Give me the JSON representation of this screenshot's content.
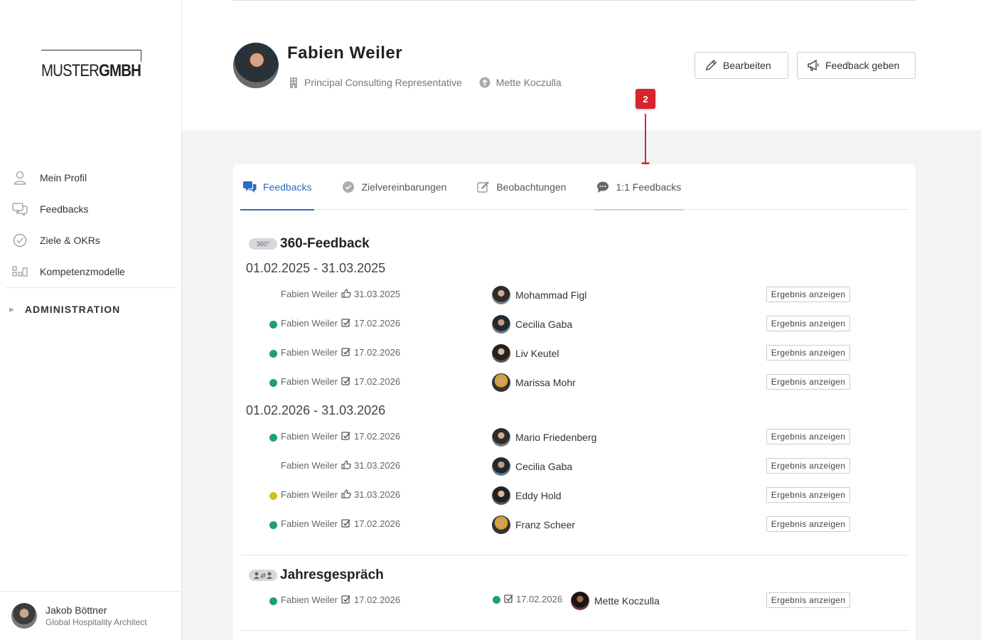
{
  "app": {
    "logo_light": "MUSTER",
    "logo_bold": "GMBH"
  },
  "sidebar": {
    "items": [
      {
        "label": "Mein Profil",
        "icon": "user-icon"
      },
      {
        "label": "Feedbacks",
        "icon": "chat-bubbles-icon"
      },
      {
        "label": "Ziele & OKRs",
        "icon": "check-circle-icon"
      },
      {
        "label": "Kompetenzmodelle",
        "icon": "model-blocks-icon"
      }
    ],
    "admin_label": "ADMINISTRATION",
    "user": {
      "name": "Jakob Böttner",
      "role": "Global Hospitality Architect"
    }
  },
  "profile": {
    "name": "Fabien Weiler",
    "position": "Principal Consulting Representative",
    "manager": "Mette Koczulla",
    "edit_label": "Bearbeiten",
    "feedback_label": "Feedback geben"
  },
  "annotation": {
    "number": "2",
    "color": "#d6252b"
  },
  "tabs": [
    {
      "label": "Feedbacks",
      "icon": "chat-bubbles-icon",
      "active": true
    },
    {
      "label": "Zielvereinbarungen",
      "icon": "check-circle-icon"
    },
    {
      "label": "Beobachtungen",
      "icon": "edit-icon"
    },
    {
      "label": "1:1 Feedbacks",
      "icon": "speech-icon"
    }
  ],
  "sections": {
    "feedback360": {
      "badge": "360°",
      "title": "360-Feedback",
      "periods": [
        {
          "label": "01.02.2025 - 31.03.2025",
          "rows": [
            {
              "status": "none",
              "person": "Fabien Weiler",
              "status_icon": "thumb-icon",
              "date": "31.03.2025",
              "reviewer": "Mohammad Figl",
              "action": "Ergebnis anzeigen"
            },
            {
              "status": "green",
              "person": "Fabien Weiler",
              "status_icon": "checkbox-icon",
              "date": "17.02.2026",
              "reviewer": "Cecilia Gaba",
              "action": "Ergebnis anzeigen"
            },
            {
              "status": "green",
              "person": "Fabien Weiler",
              "status_icon": "checkbox-icon",
              "date": "17.02.2026",
              "reviewer": "Liv Keutel",
              "action": "Ergebnis anzeigen"
            },
            {
              "status": "green",
              "person": "Fabien Weiler",
              "status_icon": "checkbox-icon",
              "date": "17.02.2026",
              "reviewer": "Marissa Mohr",
              "action": "Ergebnis anzeigen"
            }
          ]
        },
        {
          "label": "01.02.2026 - 31.03.2026",
          "rows": [
            {
              "status": "green",
              "person": "Fabien Weiler",
              "status_icon": "checkbox-icon",
              "date": "17.02.2026",
              "reviewer": "Mario Friedenberg",
              "action": "Ergebnis anzeigen"
            },
            {
              "status": "none",
              "person": "Fabien Weiler",
              "status_icon": "thumb-icon",
              "date": "31.03.2026",
              "reviewer": "Cecilia Gaba",
              "action": "Ergebnis anzeigen"
            },
            {
              "status": "yellow",
              "person": "Fabien Weiler",
              "status_icon": "thumb-icon",
              "date": "31.03.2026",
              "reviewer": "Eddy Hold",
              "action": "Ergebnis anzeigen"
            },
            {
              "status": "green",
              "person": "Fabien Weiler",
              "status_icon": "checkbox-icon",
              "date": "17.02.2026",
              "reviewer": "Franz Scheer",
              "action": "Ergebnis anzeigen"
            }
          ]
        }
      ]
    },
    "jahresgespraech": {
      "title": "Jahresgespräch",
      "row": {
        "person": "Fabien Weiler",
        "date": "17.02.2026",
        "reviewer_date": "17.02.2026",
        "reviewer": "Mette Koczulla",
        "action": "Ergebnis anzeigen"
      }
    }
  },
  "colors": {
    "accent": "#2b6dc4",
    "status_green": "#1f9e7a",
    "status_yellow": "#c9c21a"
  }
}
